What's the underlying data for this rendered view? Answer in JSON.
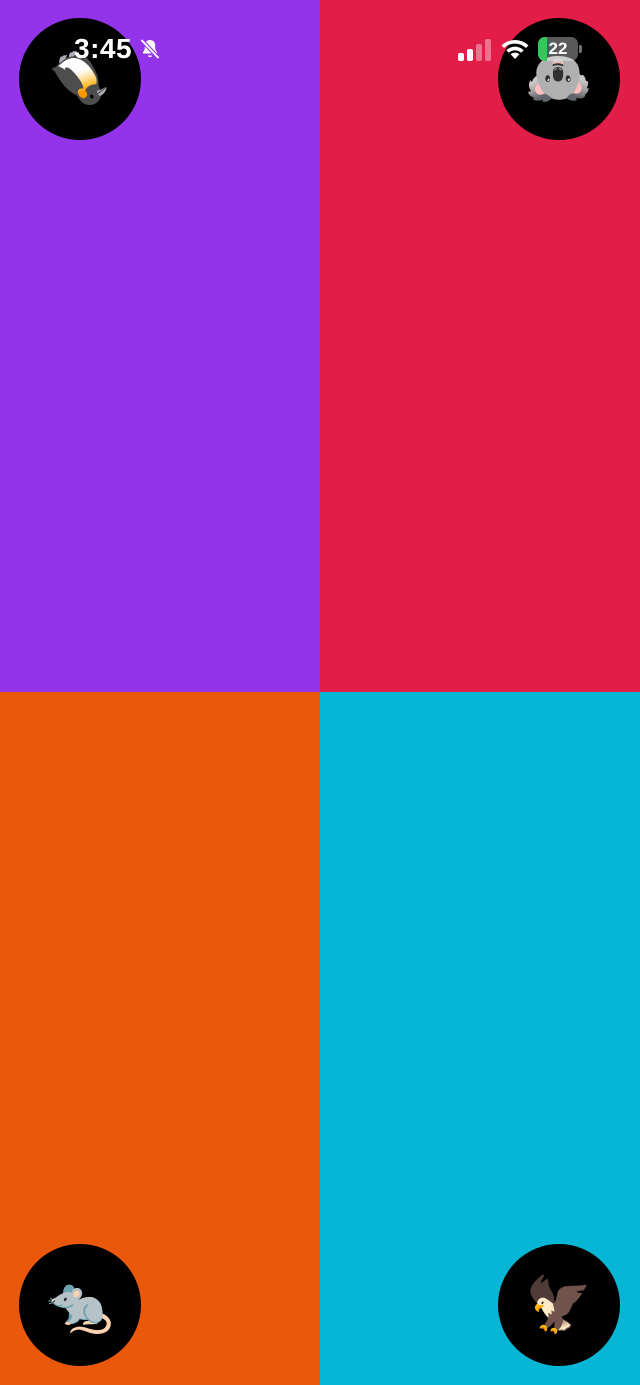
{
  "status_bar": {
    "time": "3:45",
    "battery_percent": "22",
    "battery_level": 0.22,
    "silent_mode": true,
    "signal_bars_active": 2,
    "icons": [
      "bell-slash-icon",
      "cellular-signal-icon",
      "wifi-icon",
      "battery-charging-icon"
    ]
  },
  "players": [
    {
      "position": "top-left",
      "color": "#9333EA",
      "animal": "penguin",
      "emoji": "🐧"
    },
    {
      "position": "top-right",
      "color": "#E11D48",
      "animal": "koala",
      "emoji": "🐨"
    },
    {
      "position": "bottom-left",
      "color": "#EA580C",
      "animal": "rat",
      "emoji": "🐀"
    },
    {
      "position": "bottom-right",
      "color": "#06B6D4",
      "animal": "eagle",
      "emoji": "🦅"
    }
  ]
}
